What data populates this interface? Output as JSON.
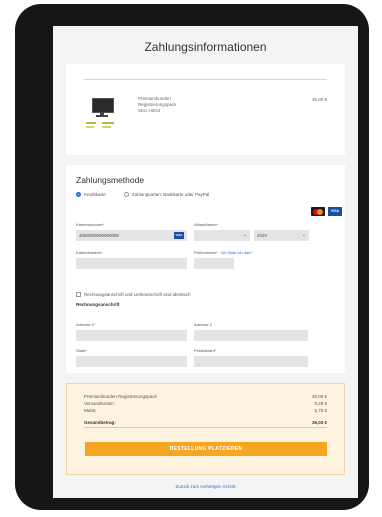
{
  "page": {
    "title": "Zahlungsinformationen"
  },
  "cart": {
    "product_name_lines": [
      "Premiumkunden",
      "Registrierungspack",
      "SKU H2G4"
    ],
    "price": "30,00 €"
  },
  "payment": {
    "heading": "Zahlungsmethode",
    "method_options": [
      {
        "label": "Kreditkarte",
        "selected": true
      },
      {
        "label": "Zahlungsarten: Bankkarte oder PayPal",
        "selected": false
      }
    ],
    "card_number": {
      "label": "Kartennummer*",
      "value": "4050000000000000"
    },
    "expiry": {
      "label": "Ablaufdatum*",
      "month": "",
      "year": "2020"
    },
    "card_holder": {
      "label": "Karteninhaber*",
      "value": ""
    },
    "cvv": {
      "label": "Prüfnummer*",
      "help_link": "Wo finde ich das?",
      "value": ""
    },
    "same_address_label": "Rechnungsanschrift und Lieferanschrift sind identisch",
    "billing_heading": "Rechnungsanschrift",
    "address1_label": "Adresse 1*",
    "address2_label": "Adresse 2",
    "city_label": "Stadt*",
    "zip_label": "Postleitzahl*"
  },
  "summary": {
    "rows": [
      {
        "label": "Premiumkunden-Registrierungspack",
        "value": "30,00 €"
      },
      {
        "label": "Versandkosten",
        "value": "0,28 €"
      },
      {
        "label": "MwSt.",
        "value": "5,75 €"
      }
    ],
    "total_label": "Gesamtbetrag:",
    "total_value": "36,03 €",
    "order_button": "BESTELLUNG PLATZIEREN"
  },
  "back_link": "Zurück zum vorherigen Schritt",
  "colors": {
    "accent": "#f5a623",
    "summary_bg": "#fdf3df",
    "link": "#1a73e8",
    "frame": "#161616"
  }
}
